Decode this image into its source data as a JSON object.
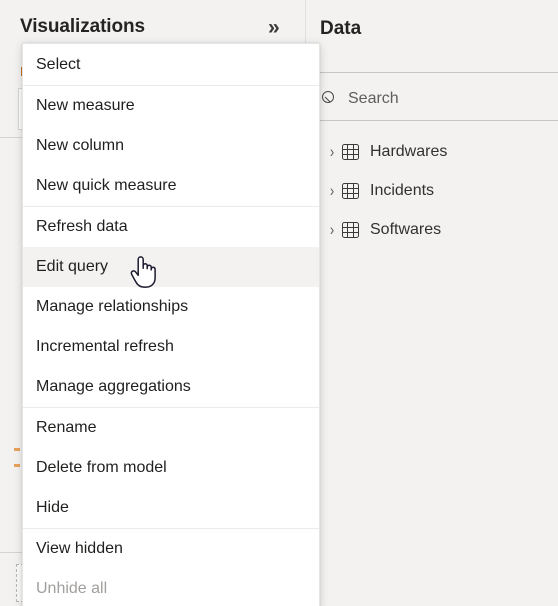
{
  "window": {
    "background_color": "#f3f2f1"
  },
  "visualizations_panel": {
    "title": "Visualizations",
    "expand_icon": "chevron-double-right-icon",
    "expand_glyph": "»",
    "subheader_partial": "B",
    "accent_color": "#c26c18"
  },
  "data_panel": {
    "title": "Data",
    "search": {
      "icon": "search-icon",
      "placeholder": "Search",
      "value": ""
    },
    "tree": [
      {
        "label": "Hardwares",
        "icon": "table-icon",
        "chevron": "›",
        "expanded": false
      },
      {
        "label": "Incidents",
        "icon": "table-icon",
        "chevron": "›",
        "expanded": false
      },
      {
        "label": "Softwares",
        "icon": "table-icon",
        "chevron": "›",
        "expanded": false
      }
    ]
  },
  "context_menu": {
    "highlighted_item": "Edit query",
    "cursor": "pointing-hand-cursor",
    "highlight_color": "#f3f2f1",
    "items": [
      {
        "label": "Select",
        "disabled": false,
        "highlighted": false,
        "separator_after": true
      },
      {
        "label": "New measure",
        "disabled": false,
        "highlighted": false,
        "separator_after": false
      },
      {
        "label": "New column",
        "disabled": false,
        "highlighted": false,
        "separator_after": false
      },
      {
        "label": "New quick measure",
        "disabled": false,
        "highlighted": false,
        "separator_after": true
      },
      {
        "label": "Refresh data",
        "disabled": false,
        "highlighted": false,
        "separator_after": false
      },
      {
        "label": "Edit query",
        "disabled": false,
        "highlighted": true,
        "separator_after": false
      },
      {
        "label": "Manage relationships",
        "disabled": false,
        "highlighted": false,
        "separator_after": false
      },
      {
        "label": "Incremental refresh",
        "disabled": false,
        "highlighted": false,
        "separator_after": false
      },
      {
        "label": "Manage aggregations",
        "disabled": false,
        "highlighted": false,
        "separator_after": true
      },
      {
        "label": "Rename",
        "disabled": false,
        "highlighted": false,
        "separator_after": false
      },
      {
        "label": "Delete from model",
        "disabled": false,
        "highlighted": false,
        "separator_after": false
      },
      {
        "label": "Hide",
        "disabled": false,
        "highlighted": false,
        "separator_after": true
      },
      {
        "label": "View hidden",
        "disabled": false,
        "highlighted": false,
        "separator_after": false
      },
      {
        "label": "Unhide all",
        "disabled": true,
        "highlighted": false,
        "separator_after": false
      }
    ]
  }
}
